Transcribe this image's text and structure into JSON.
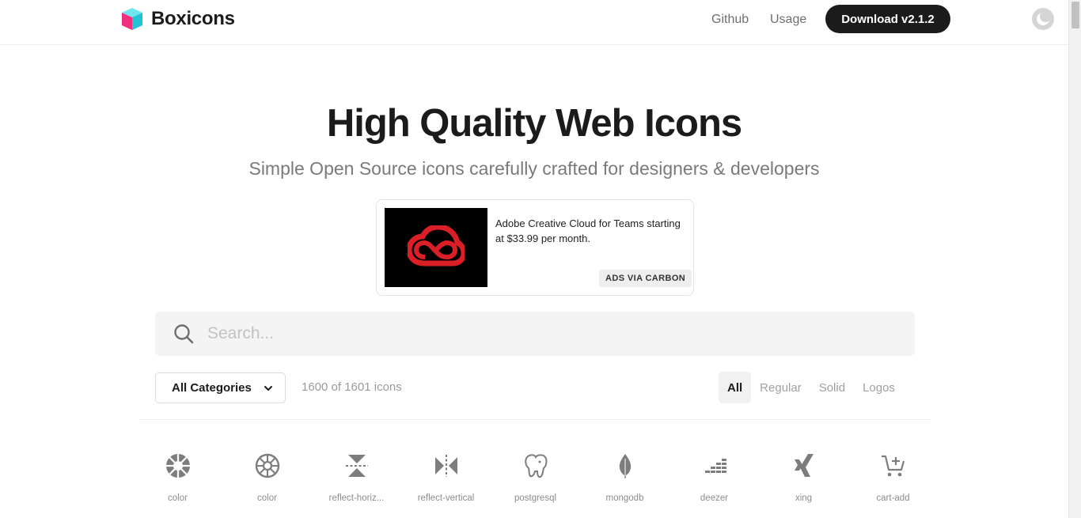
{
  "brand": {
    "name": "Boxicons"
  },
  "nav": {
    "github": "Github",
    "usage": "Usage",
    "download": "Download v2.1.2"
  },
  "hero": {
    "title": "High Quality Web Icons",
    "subtitle": "Simple Open Source icons carefully crafted for designers & developers"
  },
  "ad": {
    "text": "Adobe Creative Cloud for Teams starting at $33.99 per month.",
    "via": "ADS VIA CARBON"
  },
  "search": {
    "placeholder": "Search..."
  },
  "filters": {
    "category": "All Categories",
    "count": "1600 of 1601 icons",
    "types": [
      "All",
      "Regular",
      "Solid",
      "Logos"
    ],
    "active": "All"
  },
  "icons": [
    {
      "name": "color",
      "icon": "color-solid-icon"
    },
    {
      "name": "color",
      "icon": "color-regular-icon"
    },
    {
      "name": "reflect-horiz...",
      "icon": "reflect-horizontal-icon"
    },
    {
      "name": "reflect-vertical",
      "icon": "reflect-vertical-icon"
    },
    {
      "name": "postgresql",
      "icon": "postgresql-icon"
    },
    {
      "name": "mongodb",
      "icon": "mongodb-icon"
    },
    {
      "name": "deezer",
      "icon": "deezer-icon"
    },
    {
      "name": "xing",
      "icon": "xing-icon"
    },
    {
      "name": "cart-add",
      "icon": "cart-add-icon"
    }
  ],
  "colors": {
    "brand_teal": "#3dd5e0",
    "brand_pink": "#f0307e",
    "dark": "#1b1b1b",
    "adobe_red": "#da1f26",
    "icon_gray": "#7d7d7d"
  }
}
